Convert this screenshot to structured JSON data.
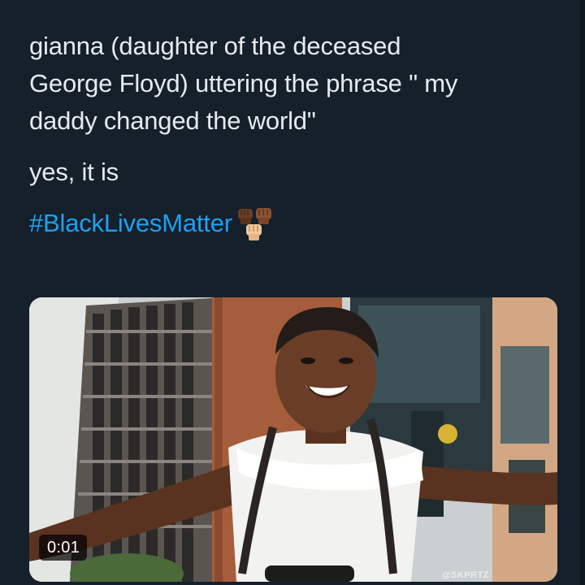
{
  "tweet": {
    "text_lines": [
      "gianna (daughter of the deceased",
      "George Floyd) uttering the phrase \" my",
      "daddy changed the world\""
    ],
    "second_paragraph": "yes, it is",
    "hashtag": "#BlackLivesMatter",
    "emoji_icon": "raised-fists-icon"
  },
  "media": {
    "type": "video",
    "timestamp": "0:01",
    "watermark": "@SKPRTZ",
    "icon": "video-thumbnail"
  },
  "colors": {
    "background": "#15202b",
    "text": "#e6ebef",
    "link": "#1da1f2"
  }
}
